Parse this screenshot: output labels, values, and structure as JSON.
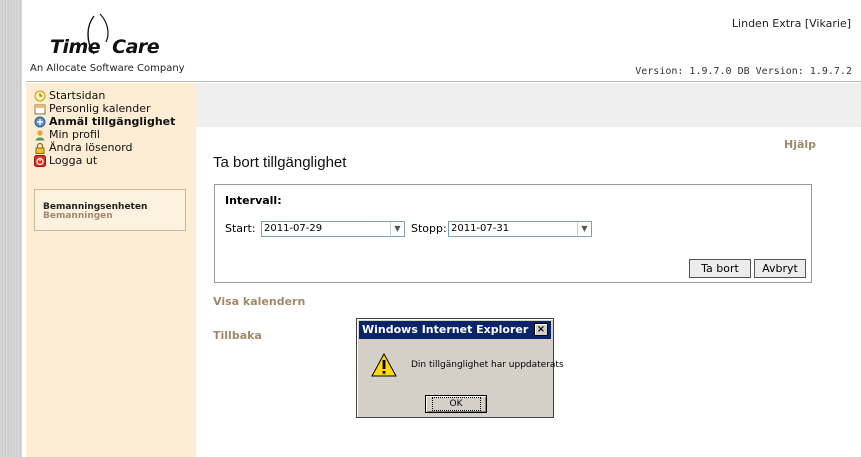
{
  "header": {
    "logo_left": "Time",
    "logo_right": "Care",
    "tagline": "An Allocate Software Company",
    "user": "Linden Extra [Vikarie]",
    "version": "Version: 1.9.7.0  DB Version: 1.9.7.2"
  },
  "sidebar": {
    "items": [
      {
        "label": "Startsidan",
        "icon": "clock-icon"
      },
      {
        "label": "Personlig kalender",
        "icon": "calendar-icon"
      },
      {
        "label": "Anmäl tillgänglighet",
        "icon": "availability-icon"
      },
      {
        "label": "Min profil",
        "icon": "user-icon"
      },
      {
        "label": "Ändra lösenord",
        "icon": "lock-icon"
      },
      {
        "label": "Logga ut",
        "icon": "power-icon"
      }
    ],
    "box": {
      "title": "Bemanningsenheten",
      "subtitle": "Bemanningen"
    }
  },
  "main": {
    "help": "Hjälp",
    "title": "Ta bort tillgänglighet",
    "interval_label": "Intervall:",
    "start_label": "Start:",
    "start_value": "2011-07-29",
    "stop_label": "Stopp:",
    "stop_value": "2011-07-31",
    "delete_button": "Ta bort",
    "cancel_button": "Avbryt",
    "show_calendar": "Visa kalendern",
    "back": "Tillbaka"
  },
  "dialog": {
    "title": "Windows Internet Explorer",
    "close": "×",
    "message": "Din tillgänglighet har uppdaterats",
    "ok": "OK",
    "icon": "warning-icon"
  },
  "colors": {
    "sidebar_bg": "#fdedd4",
    "link": "#a0896a",
    "dialog_title_bg": "#0a246a"
  }
}
